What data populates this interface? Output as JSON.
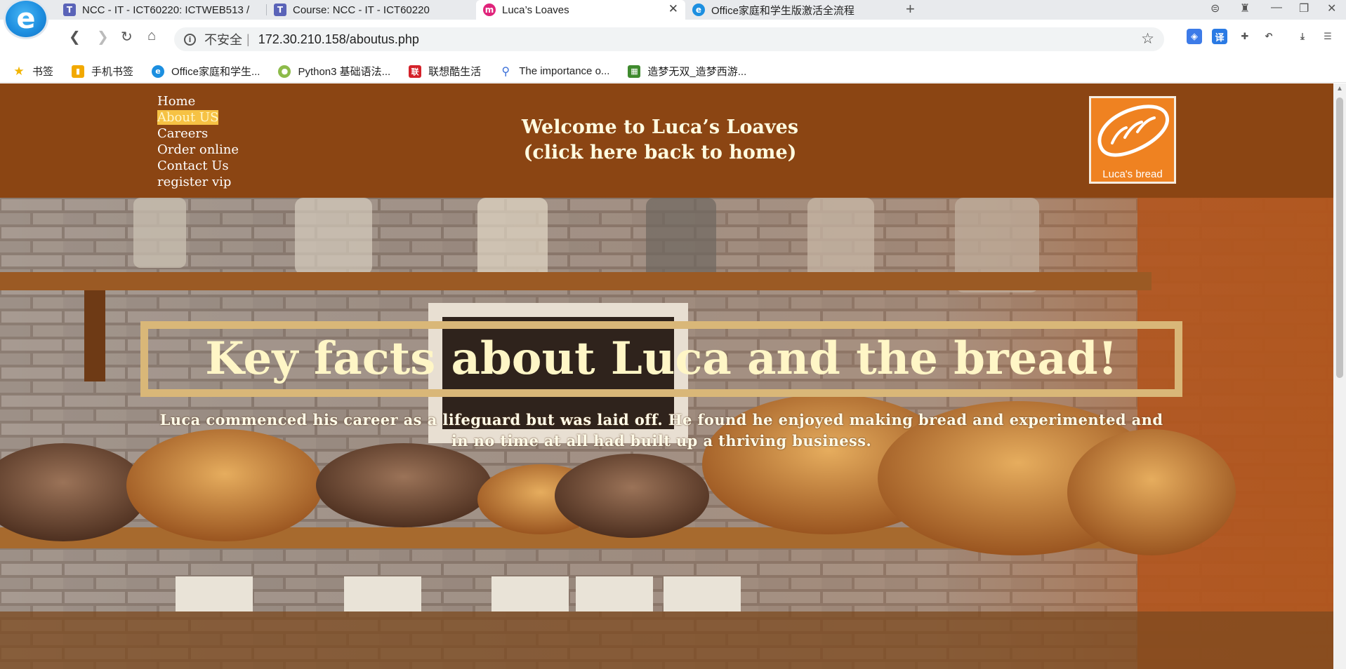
{
  "browser": {
    "tabs": [
      {
        "title": "NCC - IT - ICT60220: ICTWEB513 /",
        "favicon": "T"
      },
      {
        "title": "Course: NCC - IT - ICT60220",
        "favicon": "T"
      },
      {
        "title": "Luca’s Loaves",
        "favicon": "M",
        "active": true
      },
      {
        "title": "Office家庭和学生版激活全流程",
        "favicon": "e"
      }
    ],
    "address": {
      "security": "不安全",
      "url": "172.30.210.158/aboutus.php"
    },
    "bookmarks": [
      {
        "label": "书签",
        "icon": "star-icon"
      },
      {
        "label": "手机书签",
        "icon": "phone-icon"
      },
      {
        "label": "Office家庭和学生...",
        "icon": "e-browser-icon"
      },
      {
        "label": "Python3 基础语法...",
        "icon": "runoob-icon"
      },
      {
        "label": "联想酷生活",
        "icon": "lenovo-icon"
      },
      {
        "label": "The importance o...",
        "icon": "search-icon"
      },
      {
        "label": "造梦无双_造梦西游...",
        "icon": "game-icon"
      }
    ]
  },
  "site": {
    "nav": [
      "Home",
      "About US",
      "Careers",
      "Order online",
      "Contact Us",
      "register vip"
    ],
    "welcome_line1": "Welcome to Luca’s Loaves",
    "welcome_line2": "(click here back to home)",
    "logo_text": "Luca's bread",
    "hero_title": "Key facts about Luca and the bread!",
    "hero_text_line1": "Luca commenced his career as a lifeguard but was laid off. He found he enjoyed making bread and experimented and",
    "hero_text_line2": "in no time at all had built up a thriving business."
  },
  "colors": {
    "header_bg": "#8b4513",
    "nav_highlight": "#f6c244",
    "logo_bg": "#ef8221",
    "hero_title": "#fff6c6",
    "hero_border": "#d9b778"
  }
}
